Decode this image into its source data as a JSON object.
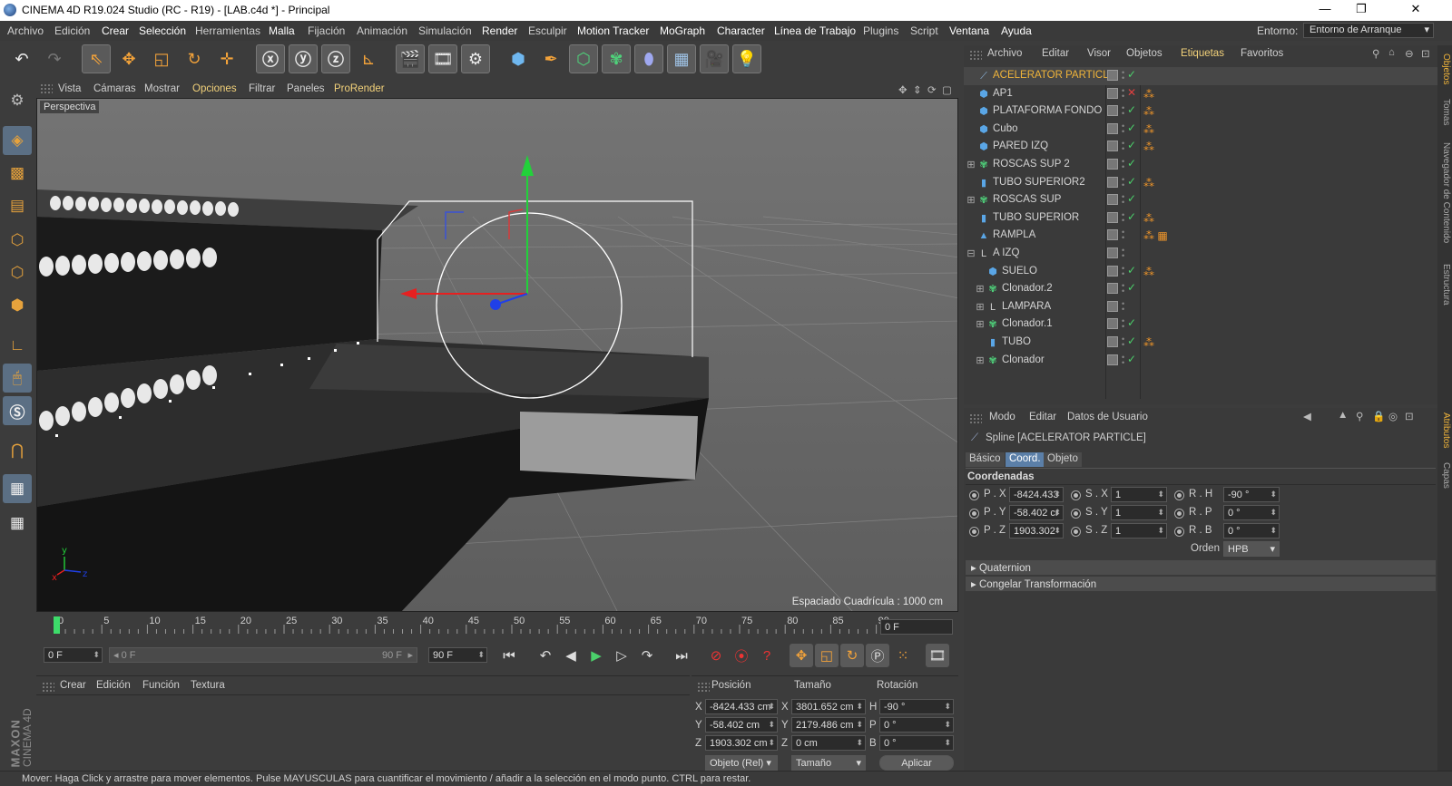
{
  "window": {
    "title": "CINEMA 4D R19.024 Studio (RC - R19) - [LAB.c4d *] - Principal",
    "minimize": "—",
    "maximize": "❐",
    "close": "✕"
  },
  "menu": {
    "items": [
      "Archivo",
      "Edición",
      "Crear",
      "Selección",
      "Herramientas",
      "Malla",
      "Fijación",
      "Animación",
      "Simulación",
      "Render",
      "Esculpir",
      "Motion Tracker",
      "MoGraph",
      "Character",
      "Línea de Trabajo",
      "Plugins",
      "Script",
      "Ventana",
      "Ayuda"
    ],
    "env_label": "Entorno:",
    "env_value": "Entorno de Arranque"
  },
  "toolbar": {
    "icons": [
      "undo-icon",
      "redo-icon",
      "live-selection-icon",
      "move-icon",
      "scale-icon",
      "rotate-icon",
      "last-tool-icon",
      "x-axis-icon",
      "y-axis-icon",
      "z-axis-icon",
      "coordinate-system-icon",
      "render-view-icon",
      "render-picture-viewer-icon",
      "render-settings-icon",
      "cube-icon",
      "pen-icon",
      "subdivision-icon",
      "cloner-icon",
      "deformer-icon",
      "floor-icon",
      "camera-icon",
      "light-icon"
    ]
  },
  "viewport": {
    "menu": [
      "Vista",
      "Cámaras",
      "Mostrar",
      "Opciones",
      "Filtrar",
      "Paneles",
      "ProRender"
    ],
    "label": "Perspectiva",
    "grid_spacing": "Espaciado Cuadrícula : 1000 cm",
    "axis_x": "x",
    "axis_y": "y",
    "axis_z": "z"
  },
  "timeline": {
    "ticks": [
      "0",
      "5",
      "10",
      "15",
      "20",
      "25",
      "30",
      "35",
      "40",
      "45",
      "50",
      "55",
      "60",
      "65",
      "70",
      "75",
      "80",
      "85",
      "90"
    ],
    "current_frame": "0 F",
    "start_frame": "0 F",
    "range_start": "0 F",
    "range_end": "90 F",
    "end_frame": "90 F"
  },
  "materials": {
    "menu": [
      "Crear",
      "Edición",
      "Función",
      "Textura"
    ]
  },
  "coords": {
    "headers": [
      "Posición",
      "Tamaño",
      "Rotación"
    ],
    "rows": [
      {
        "axis": "X",
        "pos": "-8424.433 cm",
        "size_axis": "X",
        "size": "3801.652 cm",
        "rot_axis": "H",
        "rot": "-90 °"
      },
      {
        "axis": "Y",
        "pos": "-58.402 cm",
        "size_axis": "Y",
        "size": "2179.486 cm",
        "rot_axis": "P",
        "rot": "0 °"
      },
      {
        "axis": "Z",
        "pos": "1903.302 cm",
        "size_axis": "Z",
        "size": "0 cm",
        "rot_axis": "B",
        "rot": "0 °"
      }
    ],
    "mode": "Objeto (Rel)",
    "size_mode": "Tamaño",
    "apply": "Aplicar"
  },
  "object_manager": {
    "menu": [
      "Archivo",
      "Editar",
      "Visor",
      "Objetos",
      "Etiquetas",
      "Favoritos"
    ],
    "objects": [
      {
        "name": "ACELERATOR PARTICLE",
        "icon": "spline-icon",
        "indent": 0,
        "expand": "",
        "active": true,
        "check": "✓",
        "tags": ""
      },
      {
        "name": "AP1",
        "icon": "polygon-object-icon",
        "indent": 0,
        "expand": "",
        "active": false,
        "check": "✕",
        "tags": "⁂"
      },
      {
        "name": "PLATAFORMA FONDO",
        "icon": "polygon-object-icon",
        "indent": 0,
        "expand": "",
        "active": false,
        "check": "✓",
        "tags": "⁂"
      },
      {
        "name": "Cubo",
        "icon": "polygon-object-icon",
        "indent": 0,
        "expand": "",
        "active": false,
        "check": "✓",
        "tags": "⁂"
      },
      {
        "name": "PARED IZQ",
        "icon": "polygon-object-icon",
        "indent": 0,
        "expand": "",
        "active": false,
        "check": "✓",
        "tags": "⁂"
      },
      {
        "name": "ROSCAS SUP 2",
        "icon": "cloner-icon",
        "indent": 0,
        "expand": "⊞",
        "active": false,
        "check": "✓",
        "tags": ""
      },
      {
        "name": "TUBO SUPERIOR2",
        "icon": "tube-icon",
        "indent": 0,
        "expand": "",
        "active": false,
        "check": "✓",
        "tags": "⁂"
      },
      {
        "name": "ROSCAS SUP",
        "icon": "cloner-icon",
        "indent": 0,
        "expand": "⊞",
        "active": false,
        "check": "✓",
        "tags": ""
      },
      {
        "name": "TUBO SUPERIOR",
        "icon": "tube-icon",
        "indent": 0,
        "expand": "",
        "active": false,
        "check": "✓",
        "tags": "⁂"
      },
      {
        "name": "RAMPLA",
        "icon": "cone-icon",
        "indent": 0,
        "expand": "",
        "active": false,
        "check": "",
        "tags": "⁂ ▦"
      },
      {
        "name": "A IZQ",
        "icon": "null-icon",
        "indent": 0,
        "expand": "⊟",
        "active": false,
        "check": "",
        "tags": ""
      },
      {
        "name": "SUELO",
        "icon": "polygon-object-icon",
        "indent": 1,
        "expand": "",
        "active": false,
        "check": "✓",
        "tags": "⁂"
      },
      {
        "name": "Clonador.2",
        "icon": "cloner-icon",
        "indent": 1,
        "expand": "⊞",
        "active": false,
        "check": "✓",
        "tags": ""
      },
      {
        "name": "LAMPARA",
        "icon": "null-icon",
        "indent": 1,
        "expand": "⊞",
        "active": false,
        "check": "",
        "tags": ""
      },
      {
        "name": "Clonador.1",
        "icon": "cloner-icon",
        "indent": 1,
        "expand": "⊞",
        "active": false,
        "check": "✓",
        "tags": ""
      },
      {
        "name": "TUBO",
        "icon": "tube-icon",
        "indent": 1,
        "expand": "",
        "active": false,
        "check": "✓",
        "tags": "⁂"
      },
      {
        "name": "Clonador",
        "icon": "cloner-icon",
        "indent": 1,
        "expand": "⊞",
        "active": false,
        "check": "✓",
        "tags": ""
      }
    ]
  },
  "right_tabs": [
    "Objetos",
    "Tomas",
    "Navegador de Contenido",
    "Estructura",
    "Atributos",
    "Capas"
  ],
  "attributes": {
    "menu": [
      "Modo",
      "Editar",
      "Datos de Usuario"
    ],
    "object_line": "Spline [ACELERATOR PARTICLE]",
    "tabs": [
      "Básico",
      "Coord.",
      "Objeto"
    ],
    "section": "Coordenadas",
    "fields": [
      {
        "p_label": "P . X",
        "p_val": "-8424.433",
        "s_label": "S . X",
        "s_val": "1",
        "r_label": "R . H",
        "r_val": "-90 °"
      },
      {
        "p_label": "P . Y",
        "p_val": "-58.402 cr",
        "s_label": "S . Y",
        "s_val": "1",
        "r_label": "R . P",
        "r_val": "0 °"
      },
      {
        "p_label": "P . Z",
        "p_val": "1903.302",
        "s_label": "S . Z",
        "s_val": "1",
        "r_label": "R . B",
        "r_val": "0 °"
      }
    ],
    "order_label": "Orden",
    "order_value": "HPB",
    "collapsed": [
      "Quaternion",
      "Congelar Transformación"
    ]
  },
  "status": "Mover: Haga Click y arrastre para mover elementos. Pulse MAYUSCULAS para cuantificar el movimiento / añadir a la selección en el modo punto. CTRL para restar.",
  "brand": {
    "maxon": "MAXON",
    "product": "CINEMA 4D"
  },
  "colors": {
    "accent": "#f0b43a",
    "selection": "#5b7fa8",
    "check_on": "#4bd16b",
    "check_off": "#e04040"
  }
}
